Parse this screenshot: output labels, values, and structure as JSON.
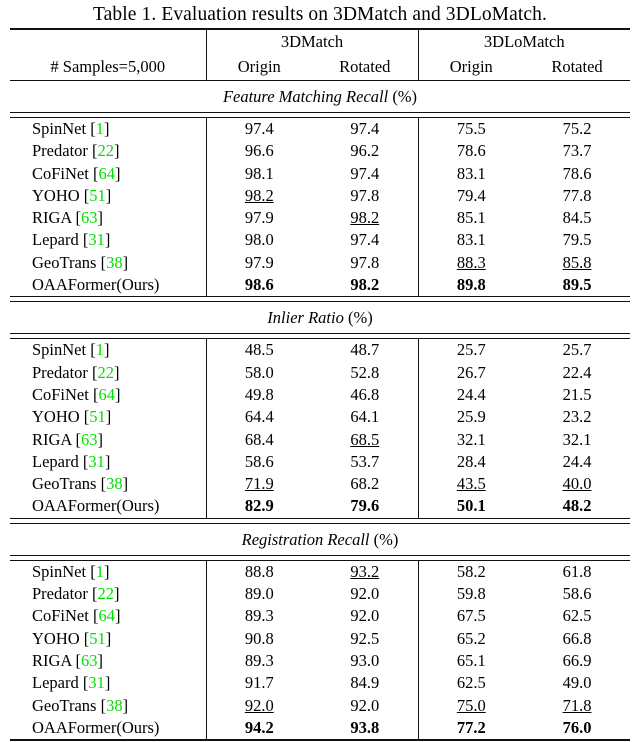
{
  "caption": "Table 1. Evaluation results on 3DMatch and 3DLoMatch.",
  "colors": {
    "citation_green": "#00e000",
    "rule": "#111111",
    "text": "#000000"
  },
  "header": {
    "corner_label": "# Samples=5,000",
    "groups": [
      {
        "name": "3DMatch",
        "subcolumns": [
          "Origin",
          "Rotated"
        ]
      },
      {
        "name": "3DLoMatch",
        "subcolumns": [
          "Origin",
          "Rotated"
        ]
      }
    ]
  },
  "methods": [
    {
      "name": "SpinNet",
      "cite": "1"
    },
    {
      "name": "Predator",
      "cite": "22"
    },
    {
      "name": "CoFiNet",
      "cite": "64"
    },
    {
      "name": "YOHO",
      "cite": "51"
    },
    {
      "name": "RIGA",
      "cite": "63"
    },
    {
      "name": "Lepard",
      "cite": "31"
    },
    {
      "name": "GeoTrans",
      "cite": "38"
    },
    {
      "name": "OAAFormer(Ours)",
      "cite": ""
    }
  ],
  "sections": [
    {
      "title": "Feature Matching Recall",
      "unit": "(%)",
      "rows": [
        {
          "label": "SpinNet",
          "cite": "1",
          "values": [
            {
              "v": "97.4",
              "style": "plain"
            },
            {
              "v": "97.4",
              "style": "plain"
            },
            {
              "v": "75.5",
              "style": "plain"
            },
            {
              "v": "75.2",
              "style": "plain"
            }
          ]
        },
        {
          "label": "Predator",
          "cite": "22",
          "values": [
            {
              "v": "96.6",
              "style": "plain"
            },
            {
              "v": "96.2",
              "style": "plain"
            },
            {
              "v": "78.6",
              "style": "plain"
            },
            {
              "v": "73.7",
              "style": "plain"
            }
          ]
        },
        {
          "label": "CoFiNet",
          "cite": "64",
          "values": [
            {
              "v": "98.1",
              "style": "plain"
            },
            {
              "v": "97.4",
              "style": "plain"
            },
            {
              "v": "83.1",
              "style": "plain"
            },
            {
              "v": "78.6",
              "style": "plain"
            }
          ]
        },
        {
          "label": "YOHO",
          "cite": "51",
          "values": [
            {
              "v": "98.2",
              "style": "second"
            },
            {
              "v": "97.8",
              "style": "plain"
            },
            {
              "v": "79.4",
              "style": "plain"
            },
            {
              "v": "77.8",
              "style": "plain"
            }
          ]
        },
        {
          "label": "RIGA",
          "cite": "63",
          "values": [
            {
              "v": "97.9",
              "style": "plain"
            },
            {
              "v": "98.2",
              "style": "second"
            },
            {
              "v": "85.1",
              "style": "plain"
            },
            {
              "v": "84.5",
              "style": "plain"
            }
          ]
        },
        {
          "label": "Lepard",
          "cite": "31",
          "values": [
            {
              "v": "98.0",
              "style": "plain"
            },
            {
              "v": "97.4",
              "style": "plain"
            },
            {
              "v": "83.1",
              "style": "plain"
            },
            {
              "v": "79.5",
              "style": "plain"
            }
          ]
        },
        {
          "label": "GeoTrans",
          "cite": "38",
          "values": [
            {
              "v": "97.9",
              "style": "plain"
            },
            {
              "v": "97.8",
              "style": "plain"
            },
            {
              "v": "88.3",
              "style": "second"
            },
            {
              "v": "85.8",
              "style": "second"
            }
          ]
        },
        {
          "label": "OAAFormer(Ours)",
          "cite": "",
          "values": [
            {
              "v": "98.6",
              "style": "best"
            },
            {
              "v": "98.2",
              "style": "best"
            },
            {
              "v": "89.8",
              "style": "best"
            },
            {
              "v": "89.5",
              "style": "best"
            }
          ]
        }
      ]
    },
    {
      "title": "Inlier Ratio",
      "unit": "(%)",
      "rows": [
        {
          "label": "SpinNet",
          "cite": "1",
          "values": [
            {
              "v": "48.5",
              "style": "plain"
            },
            {
              "v": "48.7",
              "style": "plain"
            },
            {
              "v": "25.7",
              "style": "plain"
            },
            {
              "v": "25.7",
              "style": "plain"
            }
          ]
        },
        {
          "label": "Predator",
          "cite": "22",
          "values": [
            {
              "v": "58.0",
              "style": "plain"
            },
            {
              "v": "52.8",
              "style": "plain"
            },
            {
              "v": "26.7",
              "style": "plain"
            },
            {
              "v": "22.4",
              "style": "plain"
            }
          ]
        },
        {
          "label": "CoFiNet",
          "cite": "64",
          "values": [
            {
              "v": "49.8",
              "style": "plain"
            },
            {
              "v": "46.8",
              "style": "plain"
            },
            {
              "v": "24.4",
              "style": "plain"
            },
            {
              "v": "21.5",
              "style": "plain"
            }
          ]
        },
        {
          "label": "YOHO",
          "cite": "51",
          "values": [
            {
              "v": "64.4",
              "style": "plain"
            },
            {
              "v": "64.1",
              "style": "plain"
            },
            {
              "v": "25.9",
              "style": "plain"
            },
            {
              "v": "23.2",
              "style": "plain"
            }
          ]
        },
        {
          "label": "RIGA",
          "cite": "63",
          "values": [
            {
              "v": "68.4",
              "style": "plain"
            },
            {
              "v": "68.5",
              "style": "second"
            },
            {
              "v": "32.1",
              "style": "plain"
            },
            {
              "v": "32.1",
              "style": "plain"
            }
          ]
        },
        {
          "label": "Lepard",
          "cite": "31",
          "values": [
            {
              "v": "58.6",
              "style": "plain"
            },
            {
              "v": "53.7",
              "style": "plain"
            },
            {
              "v": "28.4",
              "style": "plain"
            },
            {
              "v": "24.4",
              "style": "plain"
            }
          ]
        },
        {
          "label": "GeoTrans",
          "cite": "38",
          "values": [
            {
              "v": "71.9",
              "style": "second"
            },
            {
              "v": "68.2",
              "style": "plain"
            },
            {
              "v": "43.5",
              "style": "second"
            },
            {
              "v": "40.0",
              "style": "second"
            }
          ]
        },
        {
          "label": "OAAFormer(Ours)",
          "cite": "",
          "values": [
            {
              "v": "82.9",
              "style": "best"
            },
            {
              "v": "79.6",
              "style": "best"
            },
            {
              "v": "50.1",
              "style": "best"
            },
            {
              "v": "48.2",
              "style": "best"
            }
          ]
        }
      ]
    },
    {
      "title": "Registration Recall",
      "unit": "(%)",
      "rows": [
        {
          "label": "SpinNet",
          "cite": "1",
          "values": [
            {
              "v": "88.8",
              "style": "plain"
            },
            {
              "v": "93.2",
              "style": "second"
            },
            {
              "v": "58.2",
              "style": "plain"
            },
            {
              "v": "61.8",
              "style": "plain"
            }
          ]
        },
        {
          "label": "Predator",
          "cite": "22",
          "values": [
            {
              "v": "89.0",
              "style": "plain"
            },
            {
              "v": "92.0",
              "style": "plain"
            },
            {
              "v": "59.8",
              "style": "plain"
            },
            {
              "v": "58.6",
              "style": "plain"
            }
          ]
        },
        {
          "label": "CoFiNet",
          "cite": "64",
          "values": [
            {
              "v": "89.3",
              "style": "plain"
            },
            {
              "v": "92.0",
              "style": "plain"
            },
            {
              "v": "67.5",
              "style": "plain"
            },
            {
              "v": "62.5",
              "style": "plain"
            }
          ]
        },
        {
          "label": "YOHO",
          "cite": "51",
          "values": [
            {
              "v": "90.8",
              "style": "plain"
            },
            {
              "v": "92.5",
              "style": "plain"
            },
            {
              "v": "65.2",
              "style": "plain"
            },
            {
              "v": "66.8",
              "style": "plain"
            }
          ]
        },
        {
          "label": "RIGA",
          "cite": "63",
          "values": [
            {
              "v": "89.3",
              "style": "plain"
            },
            {
              "v": "93.0",
              "style": "plain"
            },
            {
              "v": "65.1",
              "style": "plain"
            },
            {
              "v": "66.9",
              "style": "plain"
            }
          ]
        },
        {
          "label": "Lepard",
          "cite": "31",
          "values": [
            {
              "v": "91.7",
              "style": "plain"
            },
            {
              "v": "84.9",
              "style": "plain"
            },
            {
              "v": "62.5",
              "style": "plain"
            },
            {
              "v": "49.0",
              "style": "plain"
            }
          ]
        },
        {
          "label": "GeoTrans",
          "cite": "38",
          "values": [
            {
              "v": "92.0",
              "style": "second"
            },
            {
              "v": "92.0",
              "style": "plain"
            },
            {
              "v": "75.0",
              "style": "second"
            },
            {
              "v": "71.8",
              "style": "second"
            }
          ]
        },
        {
          "label": "OAAFormer(Ours)",
          "cite": "",
          "values": [
            {
              "v": "94.2",
              "style": "best"
            },
            {
              "v": "93.8",
              "style": "best"
            },
            {
              "v": "77.2",
              "style": "best"
            },
            {
              "v": "76.0",
              "style": "best"
            }
          ]
        }
      ]
    }
  ]
}
